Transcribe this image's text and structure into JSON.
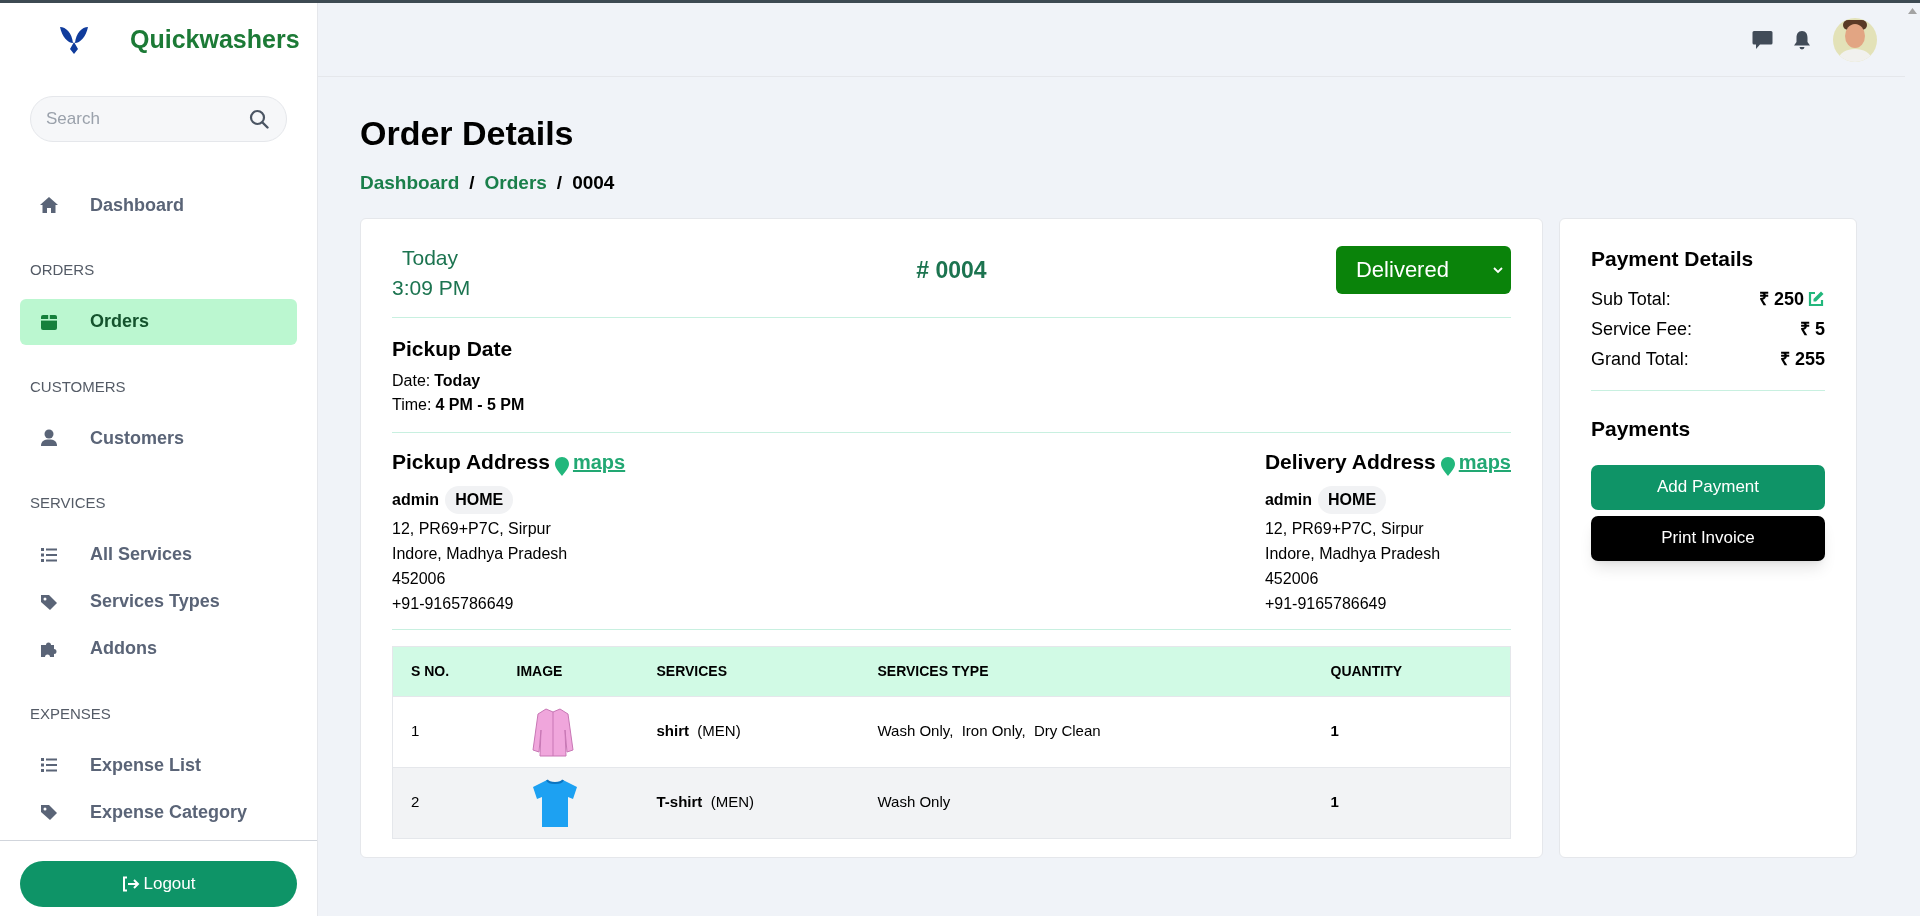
{
  "brand": {
    "name": "Quickwashers"
  },
  "search": {
    "placeholder": "Search"
  },
  "sidebar": {
    "sections": [
      {
        "items": [
          {
            "kind": "home",
            "label": "Dashboard",
            "selected": false
          }
        ]
      },
      {
        "heading": "ORDERS",
        "items": [
          {
            "kind": "box",
            "label": "Orders",
            "selected": true
          }
        ]
      },
      {
        "heading": "CUSTOMERS",
        "items": [
          {
            "kind": "user",
            "label": "Customers",
            "selected": false
          }
        ]
      },
      {
        "heading": "SERVICES",
        "items": [
          {
            "kind": "list",
            "label": "All Services",
            "selected": false
          },
          {
            "kind": "tag",
            "label": "Services Types",
            "selected": false
          },
          {
            "kind": "puzzle",
            "label": "Addons",
            "selected": false
          }
        ]
      },
      {
        "heading": "EXPENSES",
        "items": [
          {
            "kind": "list",
            "label": "Expense List",
            "selected": false
          },
          {
            "kind": "tag",
            "label": "Expense Category",
            "selected": false
          }
        ]
      }
    ]
  },
  "logout": {
    "label": "Logout"
  },
  "page": {
    "title": "Order Details",
    "breadcrumb": [
      {
        "label": "Dashboard",
        "kind": "link"
      },
      {
        "label": "/",
        "kind": "separator"
      },
      {
        "label": "Orders",
        "kind": "link"
      },
      {
        "label": "/",
        "kind": "separator"
      },
      {
        "label": "0004",
        "kind": "current"
      }
    ]
  },
  "order": {
    "day": "Today",
    "time": "3:09 PM",
    "number": "# 0004",
    "status": "Delivered"
  },
  "pickup_date": {
    "title": "Pickup Date",
    "lines": [
      {
        "label": "Date:",
        "value": "Today"
      },
      {
        "label": "Time:",
        "value": "4 PM - 5 PM"
      }
    ]
  },
  "addresses": [
    {
      "title": "Pickup Address",
      "link": "maps",
      "name": "admin",
      "tag": "HOME",
      "lines": [
        "12, PR69+P7C, Sirpur",
        "Indore, Madhya Pradesh",
        "452006",
        "+91-9165786649"
      ]
    },
    {
      "title": "Delivery Address",
      "link": "maps",
      "name": "admin",
      "tag": "HOME",
      "lines": [
        "12, PR69+P7C, Sirpur",
        "Indore, Madhya Pradesh",
        "452006",
        "+91-9165786649"
      ]
    }
  ],
  "table": {
    "columns": [
      "S NO.",
      "IMAGE",
      "SERVICES",
      "SERVICES TYPE",
      "QUANTITY"
    ],
    "rows": [
      {
        "sno": "1",
        "kind": "shirt",
        "service": "shirt",
        "category": "(MEN)",
        "types": "Wash Only,  Iron Only,  Dry Clean",
        "quantity": "1"
      },
      {
        "sno": "2",
        "kind": "tshirt",
        "service": "T-shirt",
        "category": "(MEN)",
        "types": "Wash Only",
        "quantity": "1"
      }
    ]
  },
  "payment": {
    "title": "Payment Details",
    "rows": [
      {
        "label": "Sub Total:",
        "value": "₹ 250",
        "editable": true
      },
      {
        "label": "Service Fee:",
        "value": "₹ 5",
        "editable": false
      },
      {
        "label": "Grand Total:",
        "value": "₹ 255",
        "editable": false
      }
    ],
    "payments_title": "Payments",
    "buttons": [
      {
        "label": "Add Payment",
        "kind": "primary"
      },
      {
        "label": "Print Invoice",
        "kind": "dark"
      }
    ]
  }
}
